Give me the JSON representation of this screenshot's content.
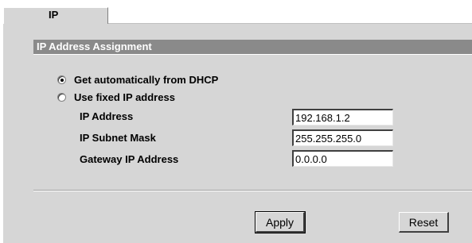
{
  "tab": {
    "label": "IP"
  },
  "section": {
    "title": "IP Address Assignment"
  },
  "assignment": {
    "options": [
      {
        "label": "Get automatically from DHCP",
        "checked": true
      },
      {
        "label": "Use fixed IP address",
        "checked": false
      }
    ]
  },
  "fields": {
    "ip_address": {
      "label": "IP Address",
      "value": "192.168.1.2"
    },
    "subnet_mask": {
      "label": "IP Subnet Mask",
      "value": "255.255.255.0"
    },
    "gateway": {
      "label": "Gateway IP Address",
      "value": "0.0.0.0"
    }
  },
  "buttons": {
    "apply": "Apply",
    "reset": "Reset"
  }
}
